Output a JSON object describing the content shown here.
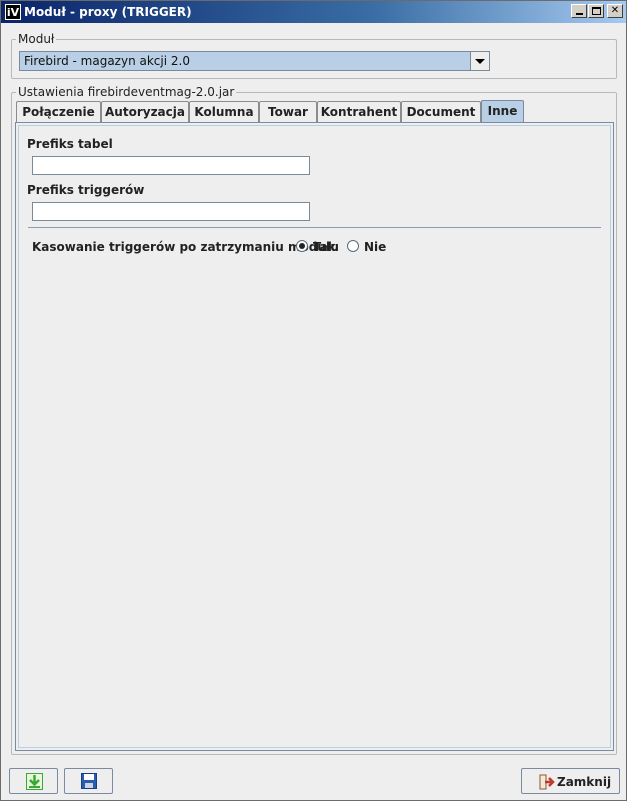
{
  "window": {
    "title": "Moduł - proxy (TRIGGER)",
    "app_icon_text": "iV"
  },
  "module_group": {
    "legend": "Moduł",
    "selected_module": "Firebird - magazyn akcji 2.0"
  },
  "settings_group": {
    "legend": "Ustawienia firebirdeventmag-2.0.jar"
  },
  "tabs": [
    {
      "label": "Połączenie",
      "active": false
    },
    {
      "label": "Autoryzacja",
      "active": false
    },
    {
      "label": "Kolumna",
      "active": false
    },
    {
      "label": "Towar",
      "active": false
    },
    {
      "label": "Kontrahent",
      "active": false
    },
    {
      "label": "Document",
      "active": false
    },
    {
      "label": "Inne",
      "active": true
    }
  ],
  "inne_tab": {
    "table_prefix_label": "Prefiks tabel",
    "table_prefix_value": "",
    "trigger_prefix_label": "Prefiks triggerów",
    "trigger_prefix_value": "",
    "delete_triggers_label": "Kasowanie triggerów po zatrzymaniu modułu",
    "option_yes": "Tak",
    "option_no": "Nie",
    "selected_option": "Tak"
  },
  "footer": {
    "close_label": "Zamknij"
  },
  "icons": {
    "import": "download-arrow-icon",
    "save": "floppy-disk-icon",
    "close": "exit-door-icon"
  },
  "colors": {
    "selection_blue": "#b8cfe5",
    "import_green": "#3aa832",
    "save_blue": "#2a5db0",
    "exit_red": "#c0392b"
  }
}
